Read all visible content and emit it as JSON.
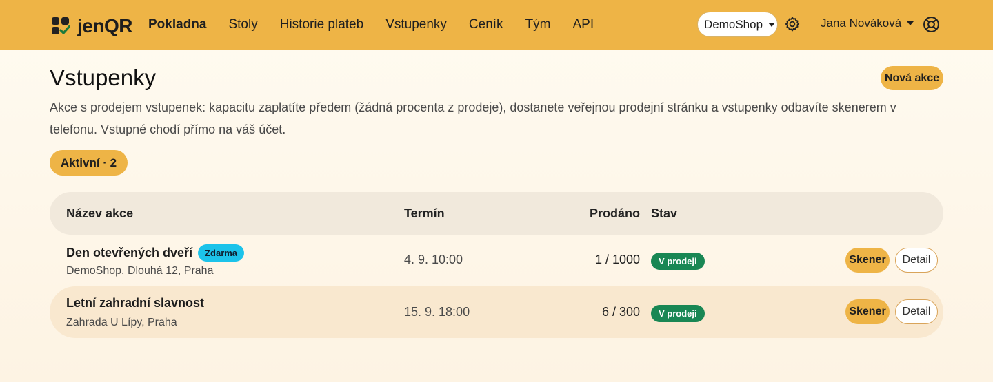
{
  "brand": {
    "name": "jenQR"
  },
  "nav": {
    "items": [
      {
        "label": "Pokladna",
        "active": true
      },
      {
        "label": "Stoly"
      },
      {
        "label": "Historie plateb"
      },
      {
        "label": "Vstupenky"
      },
      {
        "label": "Ceník"
      },
      {
        "label": "Tým"
      },
      {
        "label": "API"
      }
    ],
    "shop": "DemoShop",
    "user": "Jana Nováková"
  },
  "page": {
    "title": "Vstupenky",
    "new_button": "Nová akce",
    "description": "Akce s prodejem vstupenek: kapacitu zaplatíte předem (žádná procenta z prodeje), dostanete veřejnou prodejní stránku a vstupenky odbavíte skenerem v telefonu. Vstupné chodí přímo na váš účet.",
    "filter": "Aktivní · 2"
  },
  "table": {
    "headers": {
      "name": "Název akce",
      "date": "Termín",
      "sold": "Prodáno",
      "status": "Stav"
    },
    "rows": [
      {
        "name": "Den otevřených dveří",
        "badge": "Zdarma",
        "place": "DemoShop, Dlouhá 12, Praha",
        "date": "4. 9. 10:00",
        "sold": "1 / 1000",
        "status": "V prodeji",
        "scan": "Skener",
        "detail": "Detail"
      },
      {
        "name": "Letní zahradní slavnost",
        "place": "Zahrada U Lípy, Praha",
        "date": "15. 9. 18:00",
        "sold": "6 / 300",
        "status": "V prodeji",
        "scan": "Skener",
        "detail": "Detail"
      }
    ]
  },
  "colors": {
    "primary": "#eeb446",
    "success": "#198754",
    "info": "#1cc3ea"
  },
  "icons": {
    "logo": "grid-check-logo-icon",
    "settings": "gear-icon",
    "help": "lifebuoy-icon",
    "dropdown": "caret-down-icon"
  }
}
